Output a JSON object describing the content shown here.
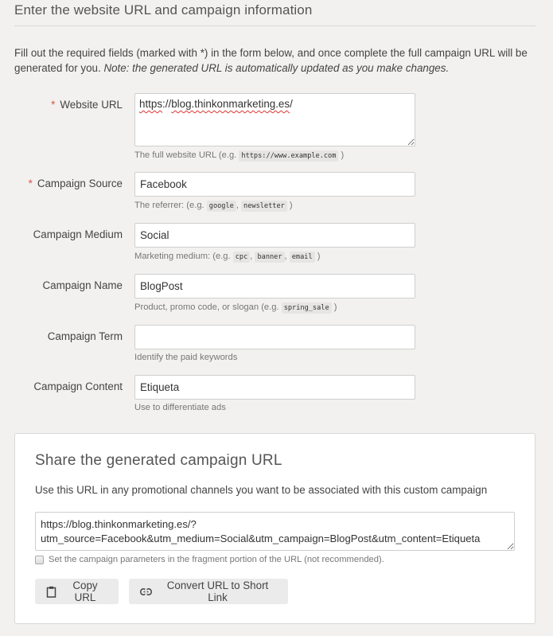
{
  "header": {
    "title": "Enter the website URL and campaign information"
  },
  "intro": {
    "text": "Fill out the required fields (marked with *) in the form below, and once complete the full campaign URL will be generated for you.",
    "note": "Note: the generated URL is automatically updated as you make changes."
  },
  "fields": [
    {
      "label": "Website URL",
      "required": true,
      "value": "https://blog.thinkonmarketing.es/",
      "help_prefix": "The full website URL (e.g.",
      "help_examples": [
        "https://www.example.com"
      ],
      "help_suffix": ")"
    },
    {
      "label": "Campaign Source",
      "required": true,
      "value": "Facebook",
      "help_prefix": "The referrer: (e.g.",
      "help_examples": [
        "google",
        "newsletter"
      ],
      "help_suffix": ")"
    },
    {
      "label": "Campaign Medium",
      "required": false,
      "value": "Social",
      "help_prefix": "Marketing medium: (e.g.",
      "help_examples": [
        "cpc",
        "banner",
        "email"
      ],
      "help_suffix": ")"
    },
    {
      "label": "Campaign Name",
      "required": false,
      "value": "BlogPost",
      "help_prefix": "Product, promo code, or slogan (e.g.",
      "help_examples": [
        "spring_sale"
      ],
      "help_suffix": ")"
    },
    {
      "label": "Campaign Term",
      "required": false,
      "value": "",
      "help_prefix": "Identify the paid keywords"
    },
    {
      "label": "Campaign Content",
      "required": false,
      "value": "Etiqueta",
      "help_prefix": "Use to differentiate ads"
    }
  ],
  "required_marker": "*",
  "share": {
    "title": "Share the generated campaign URL",
    "description": "Use this URL in any promotional channels you want to be associated with this custom campaign",
    "generated_url": "https://blog.thinkonmarketing.es/?utm_source=Facebook&utm_medium=Social&utm_campaign=BlogPost&utm_content=Etiqueta",
    "fragment_checkbox_label": "Set the campaign parameters in the fragment portion of the URL (not recommended).",
    "fragment_checked": false,
    "copy_button": "Copy URL",
    "short_link_button": "Convert URL to Short Link"
  },
  "colors": {
    "required": "#d9534f",
    "background": "#f2f1ef",
    "button": "#ebebeb"
  }
}
